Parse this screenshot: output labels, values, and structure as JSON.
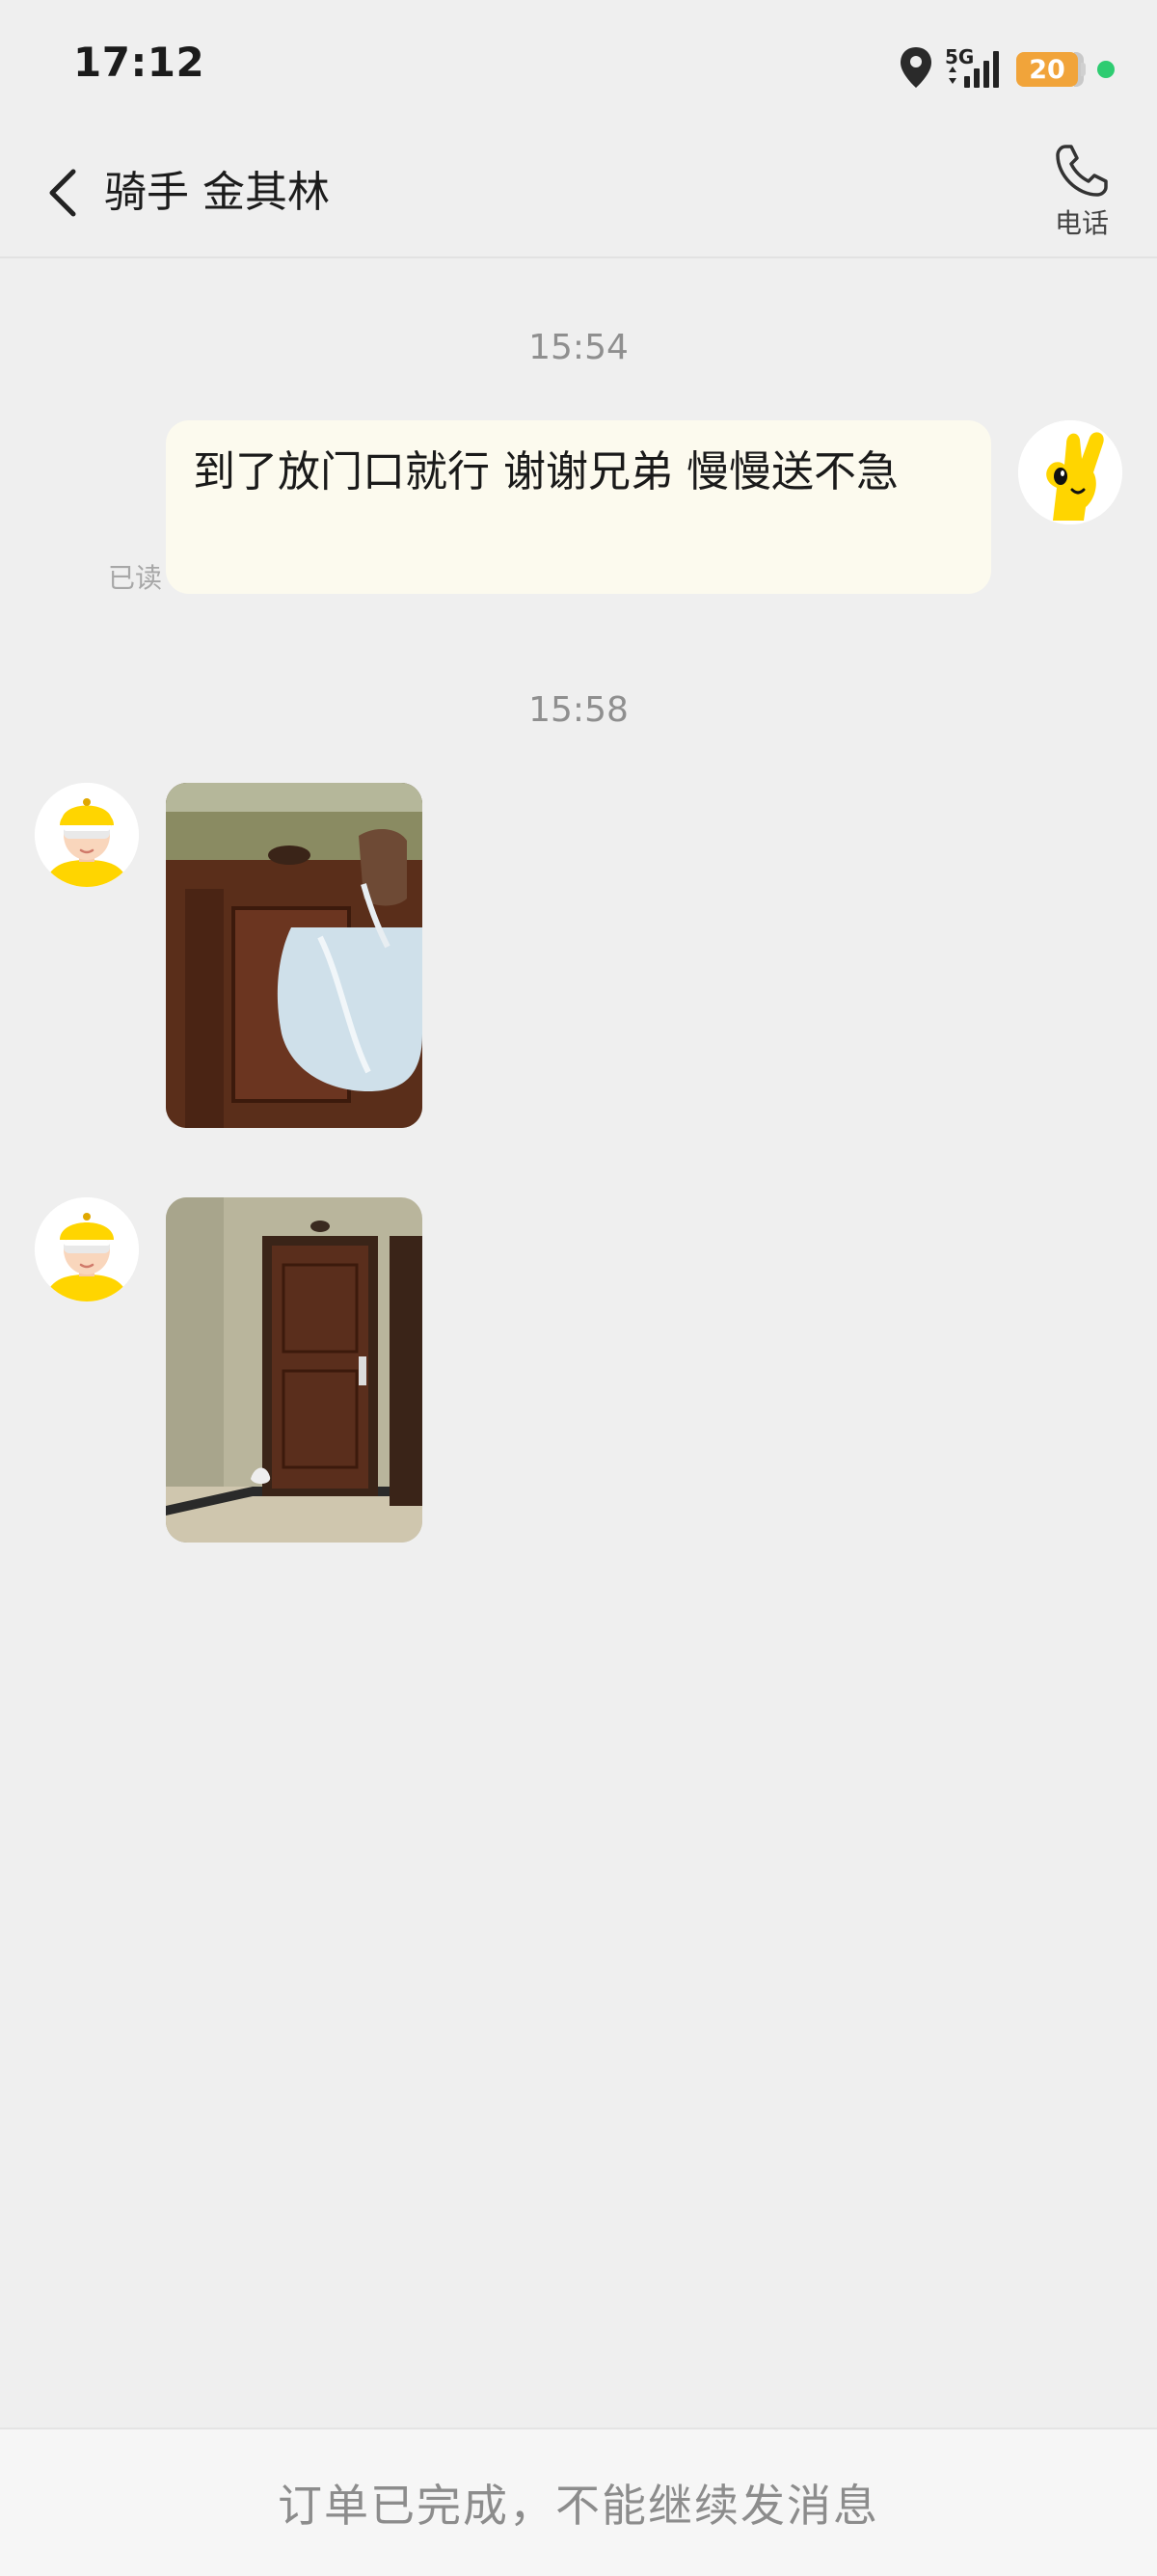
{
  "status_bar": {
    "time": "17:12",
    "network": "5G",
    "battery": "20",
    "icons": [
      "location-icon",
      "signal-icon",
      "battery-icon",
      "active-dot-icon"
    ]
  },
  "header": {
    "title": "骑手 金其林",
    "back_icon": "chevron-left-icon",
    "call_label": "电话",
    "call_icon": "phone-icon"
  },
  "messages": [
    {
      "timestamp": "15:54",
      "direction": "outgoing",
      "type": "text",
      "text": "到了放门口就行  谢谢兄弟  慢慢送不急",
      "read_status": "已读"
    },
    {
      "timestamp": "15:58",
      "direction": "incoming",
      "type": "image",
      "image_desc": "hand-holding-bag-at-door-photo"
    },
    {
      "direction": "incoming",
      "type": "image",
      "image_desc": "door-with-bag-on-floor-photo"
    }
  ],
  "footer": {
    "notice": "订单已完成，不能继续发消息"
  },
  "colors": {
    "background": "#efefef",
    "outgoing_bubble": "#fcfaee",
    "battery": "#f1a43a",
    "active_dot": "#2ecc71",
    "avatar_yellow": "#ffd500"
  }
}
